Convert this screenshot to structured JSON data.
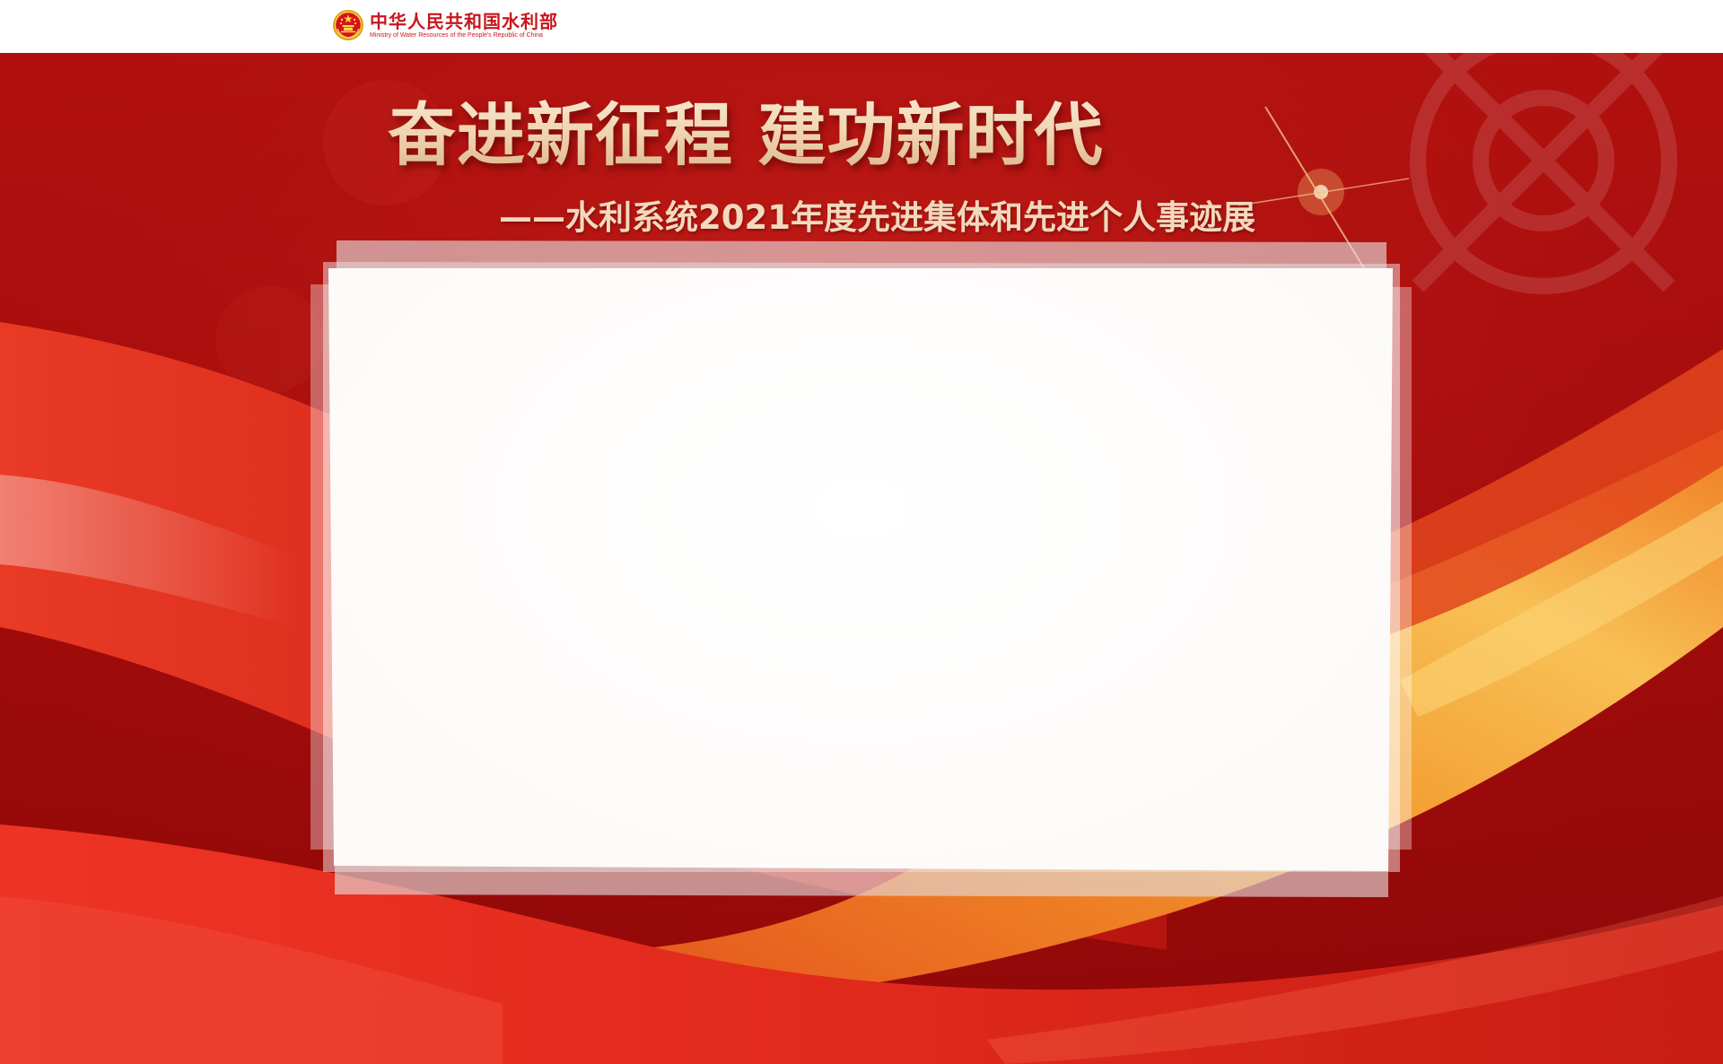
{
  "header": {
    "org_name_cn": "中华人民共和国水利部",
    "org_name_en": "Ministry of Water Resources of the People's Republic of China",
    "emblem_icon": "national-emblem-icon"
  },
  "banner": {
    "title": "奋进新征程 建功新时代",
    "subtitle": "——水利系统2021年度先进集体和先进个人事迹展"
  },
  "colors": {
    "brand_red": "#c8161d",
    "background_red": "#a80d0d",
    "ribbon_orange": "#f5a92e",
    "title_gold": "#efd4b0"
  }
}
